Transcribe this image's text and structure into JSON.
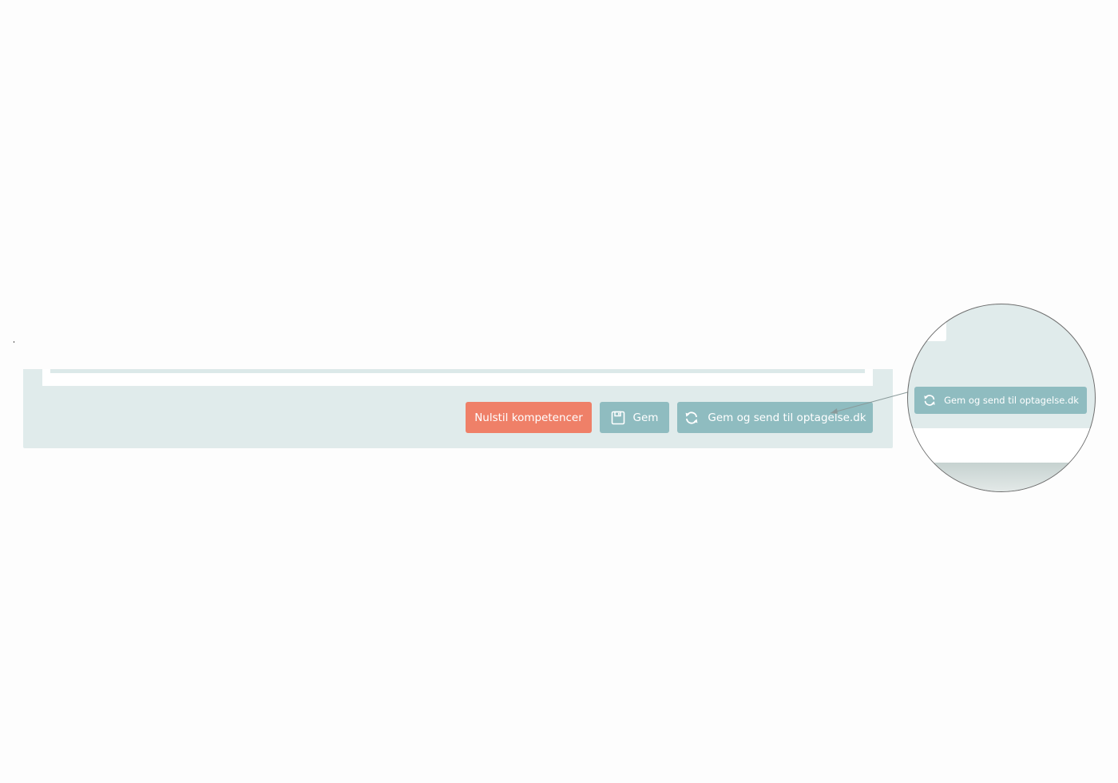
{
  "actions": {
    "reset_label": "Nulstil kompetencer",
    "save_label": "Gem",
    "save_send_label": "Gem og send til optagelse.dk"
  },
  "magnifier": {
    "button_label": "Gem og send til optagelse.dk"
  },
  "icons": {
    "save": "floppy-disk-icon",
    "sync": "sync-icon"
  },
  "colors": {
    "reset_button": "#ef8068",
    "primary_button": "#8fbcc0",
    "panel_background": "#e0ebeb"
  }
}
